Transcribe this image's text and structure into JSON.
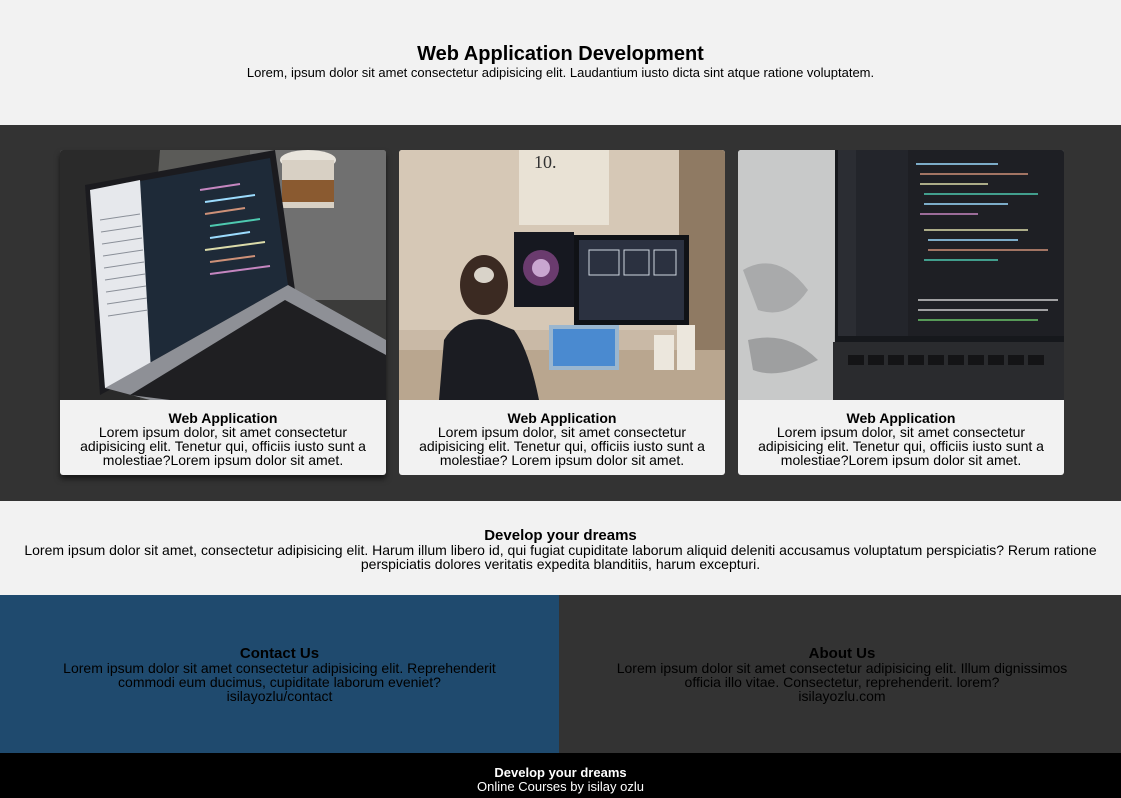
{
  "hero": {
    "title": "Web Application Development",
    "subtitle": "Lorem, ipsum dolor sit amet consectetur adipisicing elit. Laudantium iusto dicta sint atque ratione voluptatem."
  },
  "cards": [
    {
      "title": "Web Application",
      "text": "Lorem ipsum dolor, sit amet consectetur adipisicing elit. Tenetur qui, officiis iusto sunt a molestiae?Lorem ipsum dolor sit amet."
    },
    {
      "title": "Web Application",
      "text": "Lorem ipsum dolor, sit amet consectetur adipisicing elit. Tenetur qui, officiis iusto sunt a molestiae? Lorem ipsum dolor sit amet."
    },
    {
      "title": "Web Application",
      "text": "Lorem ipsum dolor, sit amet consectetur adipisicing elit. Tenetur qui, officiis iusto sunt a molestiae?Lorem ipsum dolor sit amet."
    }
  ],
  "dreams": {
    "title": "Develop your dreams",
    "text": "Lorem ipsum dolor sit amet, consectetur adipisicing elit. Harum illum libero id, qui fugiat cupiditate laborum aliquid deleniti accusamus voluptatum perspiciatis? Rerum ratione perspiciatis dolores veritatis expedita blanditiis, harum excepturi."
  },
  "contact": {
    "title": "Contact Us",
    "text": "Lorem ipsum dolor sit amet consectetur adipisicing elit. Reprehenderit commodi eum ducimus, cupiditate laborum eveniet?",
    "link": "isilayozlu/contact"
  },
  "about": {
    "title": "About Us",
    "text": "Lorem ipsum dolor sit amet consectetur adipisicing elit. Illum dignissimos officia illo vitae. Consectetur, reprehenderit. lorem?",
    "link": "isilayozlu.com"
  },
  "footer": {
    "title": "Develop your dreams",
    "subtitle": "Online Courses by isilay ozlu"
  },
  "colors": {
    "page_bg": "#f2f2f2",
    "band_bg": "#333333",
    "contact_bg": "#1f4a6e",
    "footer_bg": "#000000"
  }
}
